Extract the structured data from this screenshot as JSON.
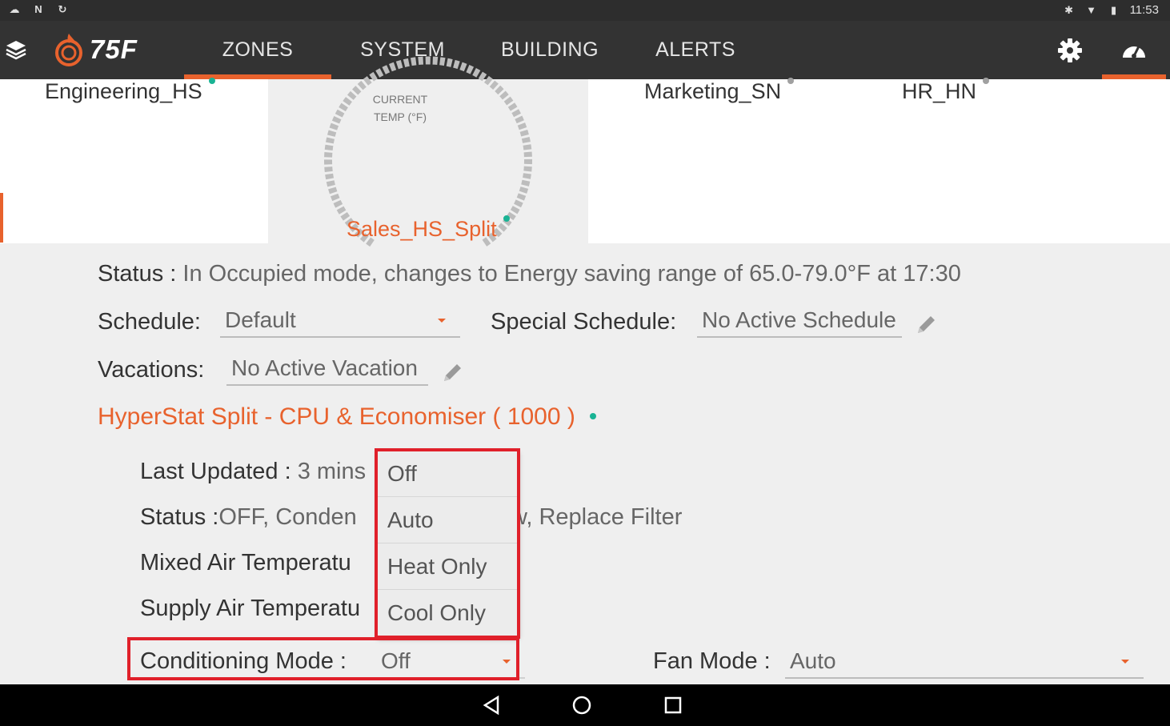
{
  "statusbar": {
    "time": "11:53"
  },
  "nav": {
    "logo": "75F",
    "tabs": [
      {
        "label": "ZONES"
      },
      {
        "label": "SYSTEM"
      },
      {
        "label": "BUILDING"
      },
      {
        "label": "ALERTS"
      }
    ],
    "active_tab": "ZONES"
  },
  "zones": {
    "items": [
      {
        "name": "Engineering_HS",
        "status_color": "#19b394"
      },
      {
        "name": "Sales_HS_Split",
        "status_color": "#19b394",
        "selected": true
      },
      {
        "name": "Marketing_SN",
        "status_color": "#a0a0a0"
      },
      {
        "name": "HR_HN",
        "status_color": "#a0a0a0"
      }
    ],
    "gauge_label_line1": "CURRENT",
    "gauge_label_line2": "TEMP (°F)"
  },
  "details": {
    "status_label": "Status :",
    "status_value": "In Occupied mode, changes to Energy saving range of 65.0-79.0°F at 17:30",
    "schedule_label": "Schedule:",
    "schedule_value": "Default",
    "special_schedule_label": "Special Schedule:",
    "special_schedule_value": "No Active Schedule",
    "vacations_label": "Vacations:",
    "vacations_value": "No Active Vacation",
    "device_title": "HyperStat Split - CPU & Economiser ( 1000 )",
    "last_updated_label": "Last Updated :",
    "last_updated_value": "3 mins",
    "device_status_label": "Status :",
    "device_status_value_left": "OFF, Conden",
    "device_status_value_right": "w, Replace Filter",
    "mixed_air_label": "Mixed Air Temperatu",
    "supply_air_label": "Supply Air Temperatu",
    "conditioning_mode_label": "Conditioning Mode :",
    "conditioning_mode_value": "Off",
    "fan_mode_label": "Fan Mode :",
    "fan_mode_value": "Auto"
  },
  "popup": {
    "options": [
      "Off",
      "Auto",
      "Heat Only",
      "Cool Only"
    ]
  },
  "colors": {
    "accent": "#e8622d",
    "online": "#19b394",
    "highlight": "#e0202a"
  }
}
